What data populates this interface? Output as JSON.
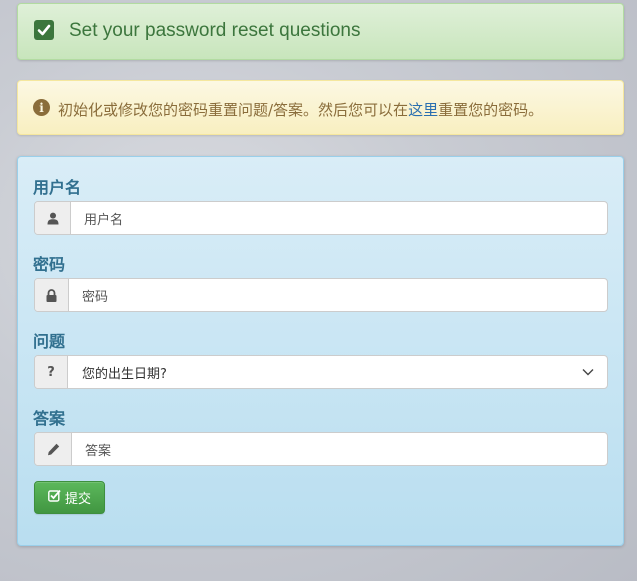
{
  "header": {
    "title": "Set your password reset questions",
    "icon": "check-square-icon",
    "color": "#3c763d"
  },
  "info": {
    "icon": "info-circle-icon",
    "text_before": "初始化或修改您的密码重置问题/答案。然后您可以在",
    "link_text": "这里",
    "text_after": "重置您的密码。",
    "color": "#8a6d3b",
    "link_color": "#2a6fb0"
  },
  "form": {
    "username": {
      "label": "用户名",
      "placeholder": "用户名",
      "icon": "user-icon"
    },
    "password": {
      "label": "密码",
      "placeholder": "密码",
      "icon": "lock-icon"
    },
    "question": {
      "label": "问题",
      "selected": "您的出生日期?",
      "icon": "question-icon"
    },
    "answer": {
      "label": "答案",
      "placeholder": "答案",
      "icon": "pencil-icon"
    },
    "submit_label": "提交",
    "submit_icon": "check-square-o-icon"
  }
}
